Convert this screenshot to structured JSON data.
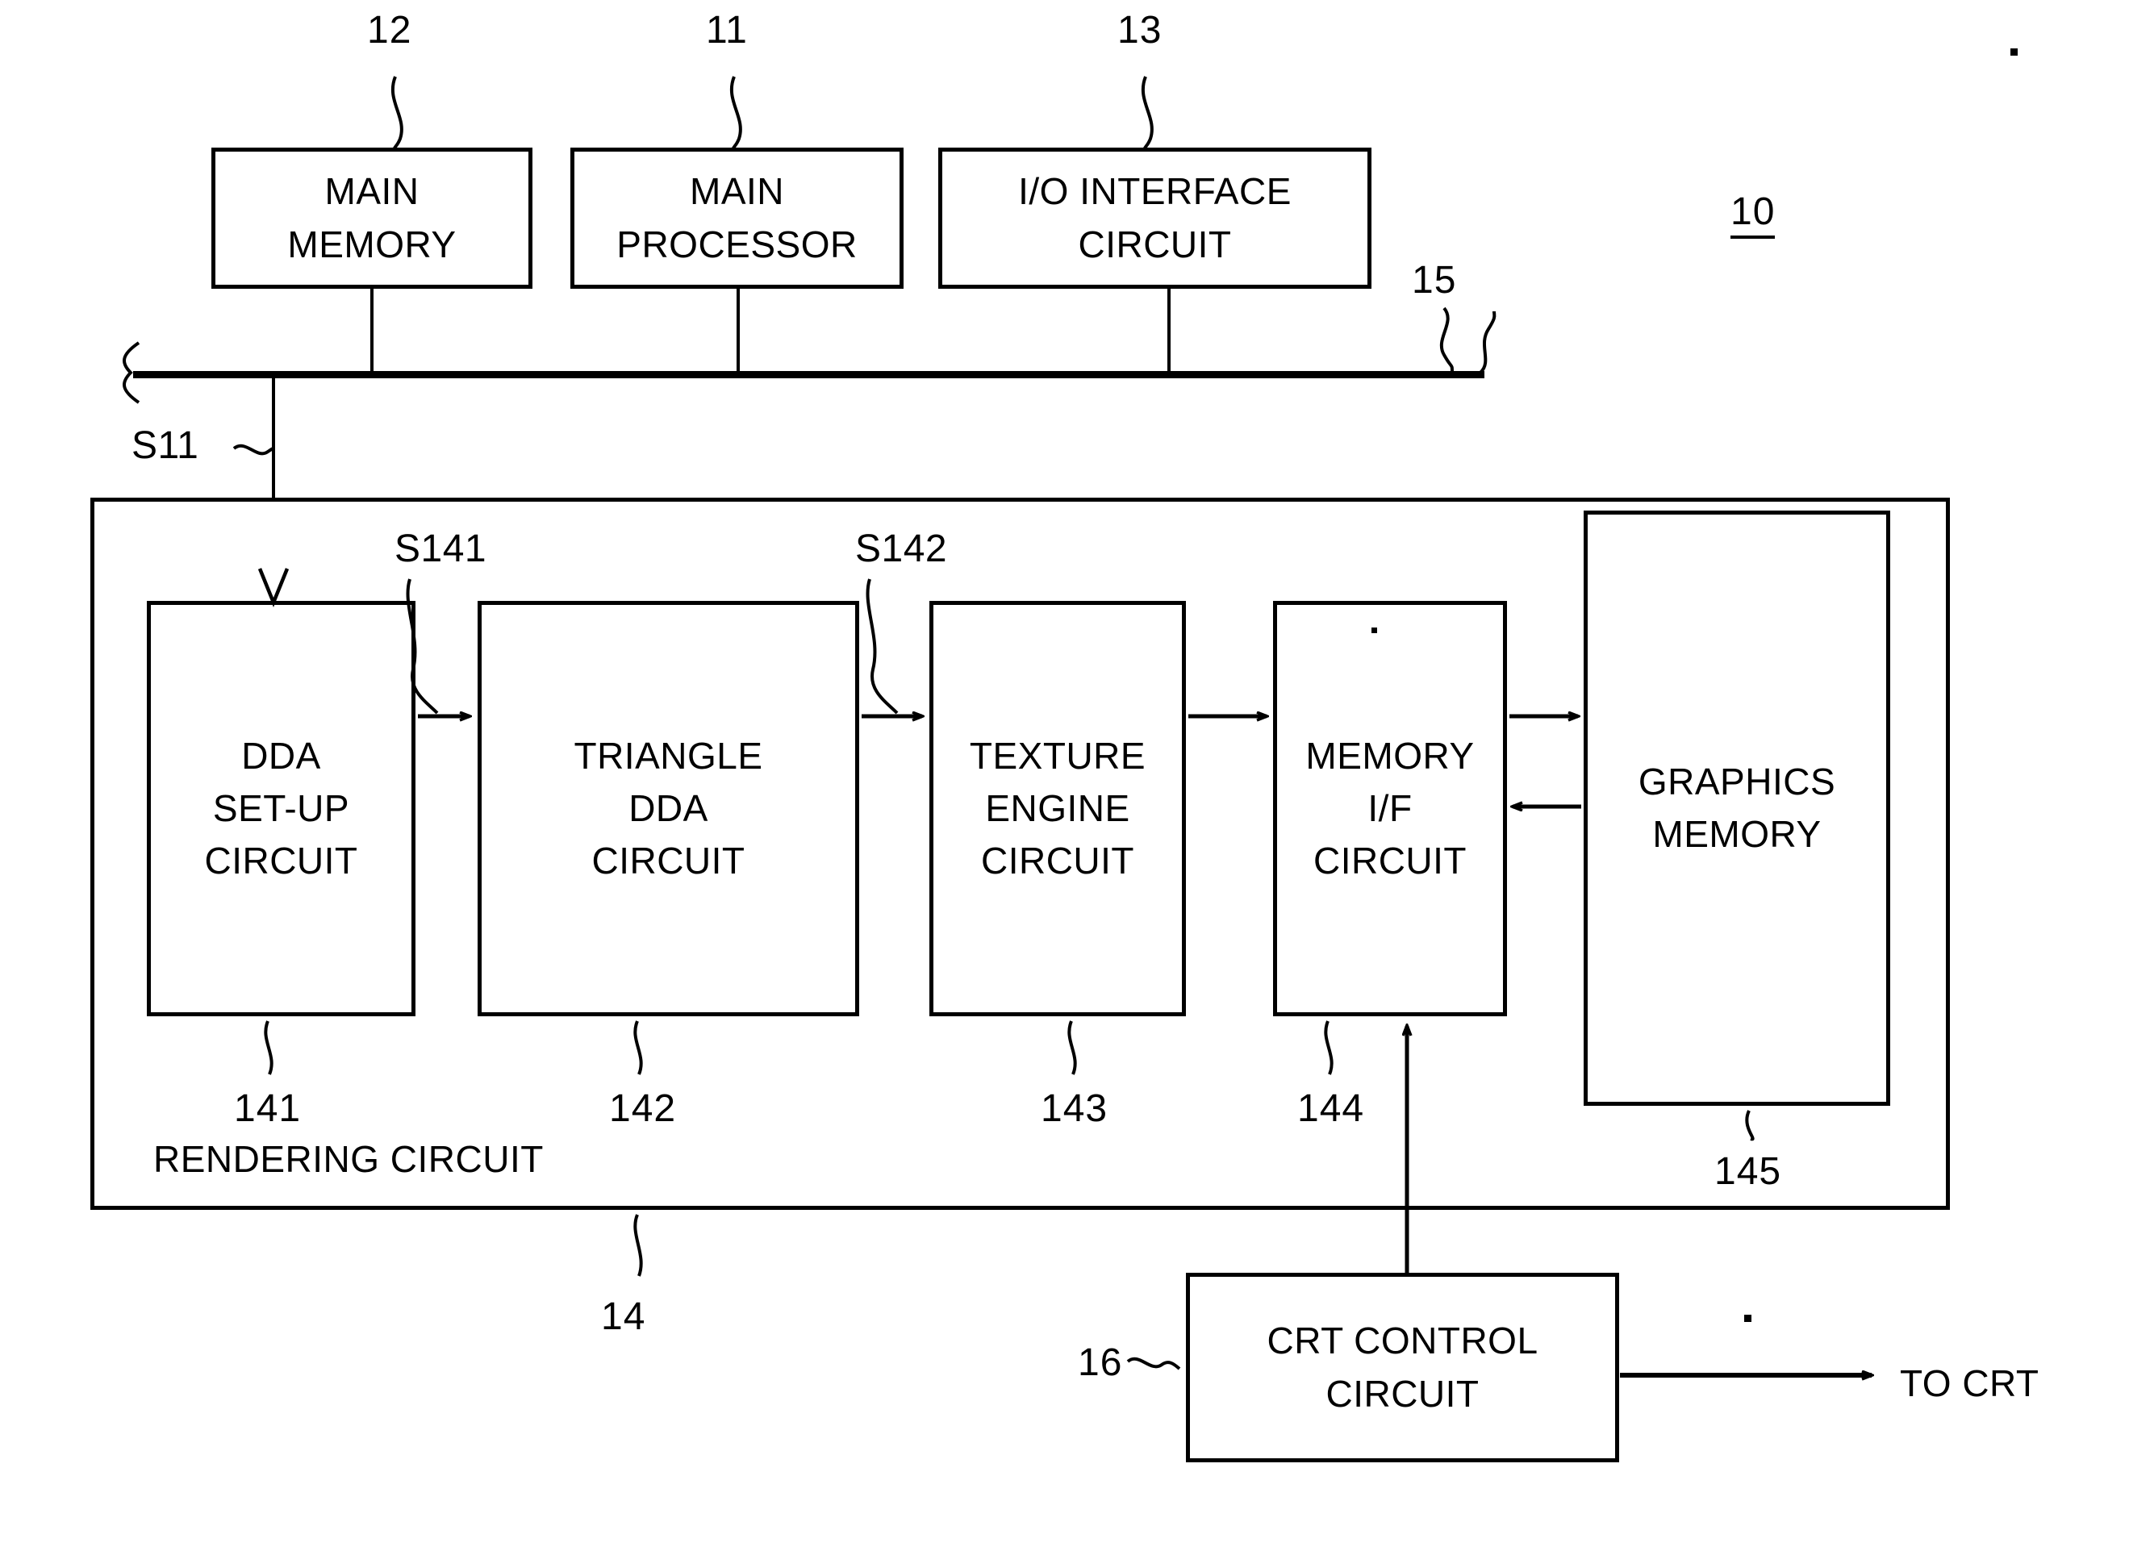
{
  "figure": {
    "type": "patent-block-diagram",
    "system_label": "10",
    "bus_label": "15",
    "signals": {
      "s11": "S11",
      "s141": "S141",
      "s142": "S142"
    },
    "rendering_circuit_caption": "RENDERING CIRCUIT",
    "rendering_circuit_label": "14",
    "to_crt_label": "TO CRT"
  },
  "top_blocks": [
    {
      "id": "main-memory",
      "ref": "12",
      "lines": [
        "MAIN",
        "MEMORY"
      ]
    },
    {
      "id": "main-processor",
      "ref": "11",
      "lines": [
        "MAIN",
        "PROCESSOR"
      ]
    },
    {
      "id": "io-interface",
      "ref": "13",
      "lines": [
        "I/O INTERFACE",
        "CIRCUIT"
      ]
    }
  ],
  "pipeline_blocks": [
    {
      "id": "dda-set-up",
      "ref": "141",
      "lines": [
        "DDA",
        "SET-UP",
        "CIRCUIT"
      ]
    },
    {
      "id": "triangle-dda",
      "ref": "142",
      "lines": [
        "TRIANGLE",
        "DDA",
        "CIRCUIT"
      ]
    },
    {
      "id": "texture-engine",
      "ref": "143",
      "lines": [
        "TEXTURE",
        "ENGINE",
        "CIRCUIT"
      ]
    },
    {
      "id": "memory-if",
      "ref": "144",
      "lines": [
        "MEMORY",
        "I/F",
        "CIRCUIT"
      ]
    },
    {
      "id": "graphics-memory",
      "ref": "145",
      "lines": [
        "GRAPHICS",
        "MEMORY"
      ]
    }
  ],
  "crt_block": {
    "id": "crt-control",
    "ref": "16",
    "lines": [
      "CRT CONTROL",
      "CIRCUIT"
    ]
  }
}
